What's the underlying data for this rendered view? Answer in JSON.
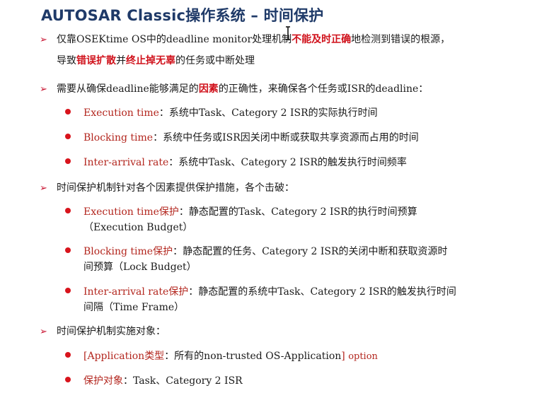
{
  "title": "AUTOSAR Classic操作系统 – 时间保护",
  "bullets": {
    "b1": {
      "a": "仅靠OSEKtime OS中的deadline monitor处理机制",
      "b": "不能及时正确",
      "c": "地检测到错误的根源，",
      "d": "导致",
      "e": "错误扩散",
      "f": "并",
      "g": "终止掉无辜",
      "h": "的任务或中断处理"
    },
    "b2": {
      "a": "需要从确保deadline能够满足的",
      "b": "因素",
      "c": "的正确性，来确保各个任务或ISR的deadline：",
      "items": [
        {
          "label": "Execution time",
          "text": "：系统中Task、Category 2 ISR的实际执行时间"
        },
        {
          "label": "Blocking time",
          "text": "：系统中任务或ISR因关闭中断或获取共享资源而占用的时间"
        },
        {
          "label": "Inter-arrival rate",
          "text": "：系统中Task、Category 2 ISR的触发执行时间频率"
        }
      ]
    },
    "b3": {
      "text": "时间保护机制针对各个因素提供保护措施，各个击破：",
      "items": [
        {
          "label": "Execution time保护",
          "text": "：静态配置的Task、Category 2 ISR的执行时间预算",
          "cont": "（Execution Budget）"
        },
        {
          "label": "Blocking time保护",
          "text": "：静态配置的任务、Category 2 ISR的关闭中断和获取资源时",
          "cont": "间预算（Lock Budget）"
        },
        {
          "label": "Inter-arrival rate保护",
          "text": "：静态配置的系统中Task、Category 2 ISR的触发执行时间",
          "cont": "间隔（Time Frame）"
        }
      ]
    },
    "b4": {
      "text": "时间保护机制实施对象：",
      "items": [
        {
          "label": "[Application类型",
          "text": "：所有的non-trusted OS-Application",
          "tail": "]",
          "opt": "option"
        },
        {
          "label": "保护对象",
          "text": "：Task、Category 2 ISR"
        }
      ]
    }
  },
  "colors": {
    "title": "#1f3a68",
    "accent_red": "#d0111b",
    "label_red": "#b3261e",
    "bullet_dot": "#d8141c"
  },
  "icons": {
    "level1_bullet": "triangle-arrow-icon",
    "level2_bullet": "red-dot-icon",
    "cursor": "text-cursor-icon"
  }
}
